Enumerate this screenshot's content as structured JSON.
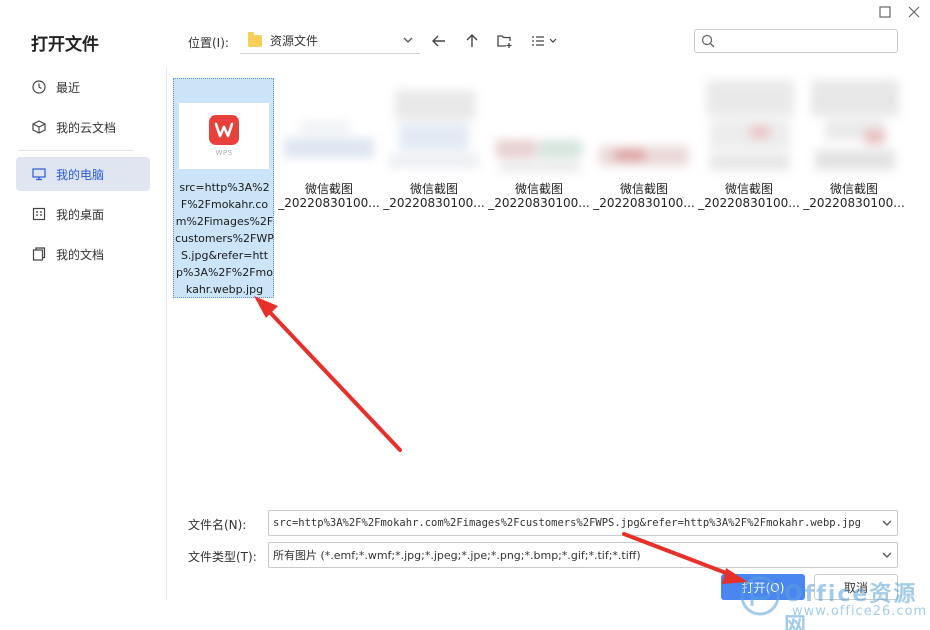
{
  "dialog": {
    "title": "打开文件"
  },
  "sidebar": {
    "items": [
      {
        "label": "最近",
        "icon": "clock-icon"
      },
      {
        "label": "我的云文档",
        "icon": "cloud-box-icon"
      },
      {
        "label": "我的电脑",
        "icon": "monitor-icon",
        "active": true
      },
      {
        "label": "我的桌面",
        "icon": "desktop-icon"
      },
      {
        "label": "我的文档",
        "icon": "documents-icon"
      }
    ]
  },
  "location": {
    "label": "位置(I):",
    "current": "资源文件"
  },
  "search": {
    "placeholder": ""
  },
  "files": {
    "selected": {
      "name": "src=http%3A%2F%2Fmokahr.com%2Fimages%2Fcustomers%2FWPS.jpg&refer=http%3A%2F%2Fmokahr.webp.jpg",
      "thumb_text": "WPS"
    },
    "items": [
      {
        "line1": "微信截图",
        "line2": "_20220830100..."
      },
      {
        "line1": "微信截图",
        "line2": "_20220830100..."
      },
      {
        "line1": "微信截图",
        "line2": "_20220830100..."
      },
      {
        "line1": "微信截图",
        "line2": "_20220830100..."
      },
      {
        "line1": "微信截图",
        "line2": "_20220830100..."
      },
      {
        "line1": "微信截图",
        "line2": "_20220830100..."
      }
    ]
  },
  "filename": {
    "label": "文件名(N):",
    "value": "src=http%3A%2F%2Fmokahr.com%2Fimages%2Fcustomers%2FWPS.jpg&refer=http%3A%2F%2Fmokahr.webp.jpg"
  },
  "filetype": {
    "label": "文件类型(T):",
    "value": "所有图片 (*.emf;*.wmf;*.jpg;*.jpeg;*.jpe;*.png;*.bmp;*.gif;*.tif;*.tiff)"
  },
  "buttons": {
    "open": "打开(O)",
    "cancel": "取消"
  },
  "watermark": {
    "name": "Office资源网",
    "url": "www.office26.com"
  },
  "colors": {
    "accent": "#4a86f2",
    "annotation": "#e8302a",
    "selection": "#cce4f7"
  }
}
